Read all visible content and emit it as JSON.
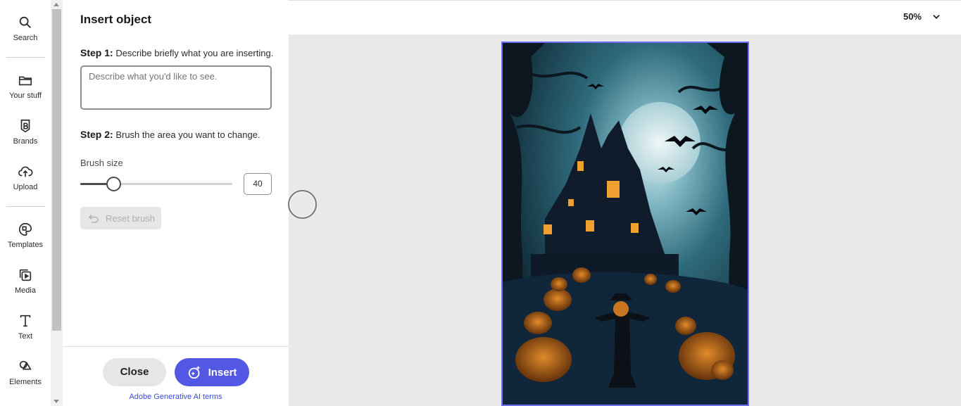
{
  "rail": {
    "items": [
      {
        "label": "Search",
        "icon": "search-icon"
      },
      {
        "label": "Your stuff",
        "icon": "folder-icon"
      },
      {
        "label": "Brands",
        "icon": "brand-icon"
      },
      {
        "label": "Upload",
        "icon": "upload-cloud-icon"
      },
      {
        "label": "Templates",
        "icon": "templates-icon"
      },
      {
        "label": "Media",
        "icon": "media-icon"
      },
      {
        "label": "Text",
        "icon": "text-icon"
      },
      {
        "label": "Elements",
        "icon": "elements-icon"
      }
    ]
  },
  "panel": {
    "title": "Insert object",
    "step1_prefix": "Step 1:",
    "step1_text": "Describe briefly what you are inserting.",
    "prompt_placeholder": "Describe what you'd like to see.",
    "step2_prefix": "Step 2:",
    "step2_text": "Brush the area you want to change.",
    "brush_label": "Brush size",
    "brush_value": "40",
    "reset_label": "Reset brush",
    "close_label": "Close",
    "insert_label": "Insert",
    "terms_link": "Adobe Generative AI terms"
  },
  "topbar": {
    "zoom": "50%"
  },
  "colors": {
    "accent": "#5258e4",
    "artboard_border": "#6f6ef2",
    "link": "#3b4cd8"
  },
  "canvas": {
    "image_description_icon": "halloween-haunted-house-image"
  }
}
